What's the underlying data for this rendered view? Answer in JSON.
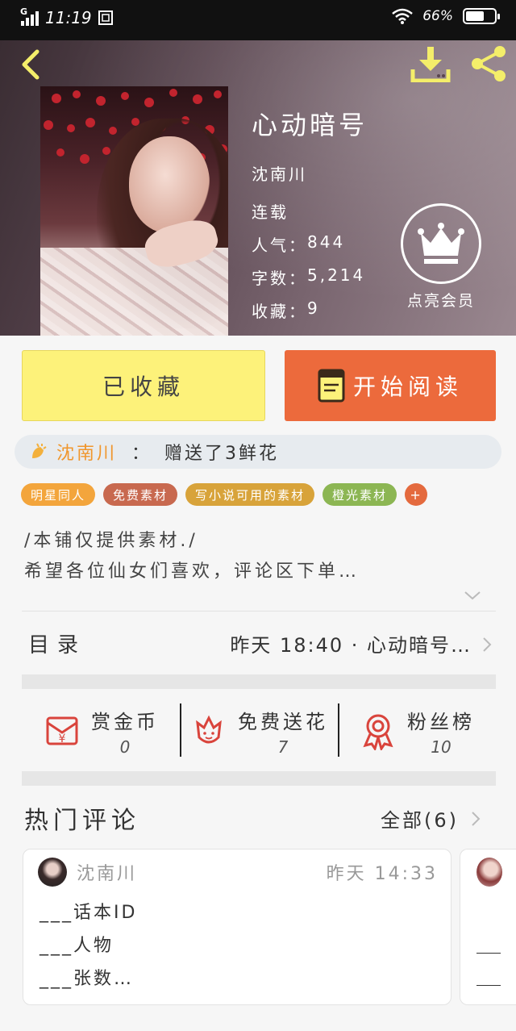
{
  "status_bar": {
    "time": "11:19",
    "battery": "66%",
    "battery_level": 0.66
  },
  "book": {
    "title": "心动暗号",
    "author": "沈南川",
    "status": "连载",
    "stats": [
      {
        "label": "人气：",
        "value": "844"
      },
      {
        "label": "字数：",
        "value": "5,214"
      },
      {
        "label": "收藏：",
        "value": "9"
      }
    ],
    "vip_label": "点亮会员"
  },
  "actions": {
    "favorite_label": "已收藏",
    "read_label": "开始阅读"
  },
  "gift": {
    "user": "沈南川",
    "separator": "：",
    "message": "赠送了3鲜花"
  },
  "tags": [
    {
      "label": "明星同人",
      "color": "#f3a53c"
    },
    {
      "label": "免费素材",
      "color": "#c8694f"
    },
    {
      "label": "写小说可用的素材",
      "color": "#d8a33a"
    },
    {
      "label": "橙光素材",
      "color": "#8cb653"
    }
  ],
  "tag_more": "+",
  "description": {
    "line1": "/本铺仅提供素材./",
    "line2": "希望各位仙女们喜欢，评论区下单…"
  },
  "toc": {
    "label": "目录",
    "latest": "昨天 18:40 · 心动暗号…"
  },
  "reward_stats": [
    {
      "label": "赏金币",
      "value": "0",
      "icon": "red-envelope-icon"
    },
    {
      "label": "免费送花",
      "value": "7",
      "icon": "flower-icon"
    },
    {
      "label": "粉丝榜",
      "value": "10",
      "icon": "medal-icon"
    }
  ],
  "comments": {
    "title": "热门评论",
    "all_label": "全部(6)",
    "items": [
      {
        "user": "沈南川",
        "time": "昨天 14:33",
        "lines": [
          "___话本ID",
          "___人物",
          "___张数…"
        ]
      }
    ]
  },
  "colors": {
    "accent_orange": "#ec6a3c",
    "fav_yellow": "#fdf27a",
    "icon_yellow": "#f4ee6a",
    "icon_red": "#d9443c"
  }
}
